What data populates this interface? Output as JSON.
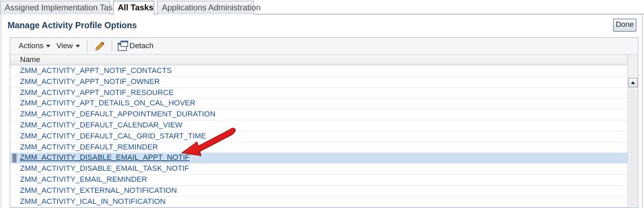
{
  "tabs": [
    {
      "label": "Assigned Implementation Tasks",
      "active": false
    },
    {
      "label": "All Tasks",
      "active": true
    },
    {
      "label": "Applications Administration",
      "active": false
    }
  ],
  "page": {
    "title": "Manage Activity Profile Options",
    "done_label": "Done"
  },
  "toolbar": {
    "actions_label": "Actions",
    "view_label": "View",
    "detach_label": "Detach",
    "edit_icon": "pencil-icon",
    "detach_icon": "detach-icon"
  },
  "table": {
    "columns": [
      "Name"
    ],
    "rows": [
      "ZMM_ACTIVITY_APPT_NOTIF_CONTACTS",
      "ZMM_ACTIVITY_APPT_NOTIF_OWNER",
      "ZMM_ACTIVITY_APPT_NOTIF_RESOURCE",
      "ZMM_ACTIVITY_APT_DETAILS_ON_CAL_HOVER",
      "ZMM_ACTIVITY_DEFAULT_APPOINTMENT_DURATION",
      "ZMM_ACTIVITY_DEFAULT_CALENDAR_VIEW",
      "ZMM_ACTIVITY_DEFAULT_CAL_GRID_START_TIME",
      "ZMM_ACTIVITY_DEFAULT_REMINDER",
      "ZMM_ACTIVITY_DISABLE_EMAIL_APPT_NOTIF",
      "ZMM_ACTIVITY_DISABLE_EMAIL_TASK_NOTIF",
      "ZMM_ACTIVITY_EMAIL_REMINDER",
      "ZMM_ACTIVITY_EXTERNAL_NOTIFICATION",
      "ZMM_ACTIVITY_ICAL_IN_NOTIFICATION"
    ],
    "selected_row": "ZMM_ACTIVITY_DISABLE_EMAIL_APPT_NOTIF"
  },
  "colors": {
    "accent": "#1c3a5c",
    "link": "#1a4d8c",
    "selected_row": "#cfe0f3",
    "annotation_arrow": "#e01010"
  }
}
